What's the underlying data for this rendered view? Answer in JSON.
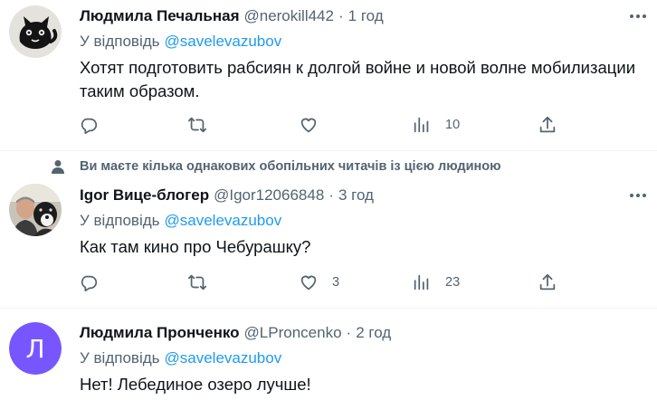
{
  "tweets": [
    {
      "name": "Людмила Печальная",
      "handle": "@nerokill442",
      "separator": "·",
      "time": "1 год",
      "reply_prefix": "У відповідь",
      "reply_to": "@savelevazubov",
      "text": "Хотят подготовить рабсиян к долгой войне и новой волне мобилизации таким образом.",
      "views": "10",
      "avatar_icon": "black-cat-avatar"
    },
    {
      "social_context": "Ви маєте кілька однакових обопільних читачів із цією людиною",
      "name": "Igor Вице-блогер",
      "handle": "@Igor12066848",
      "separator": "·",
      "time": "3 год",
      "reply_prefix": "У відповідь",
      "reply_to": "@savelevazubov",
      "text": "Как там кино про Чебурашку?",
      "likes": "3",
      "views": "23",
      "avatar_icon": "man-with-dog-avatar"
    },
    {
      "name": "Людмила Пронченко",
      "handle": "@LProncenko",
      "separator": "·",
      "time": "2 год",
      "reply_prefix": "У відповідь",
      "reply_to": "@savelevazubov",
      "text": "Нет! Лебединое озеро лучше!",
      "avatar_letter": "Л",
      "avatar_color": "#7856ff"
    }
  ],
  "colors": {
    "accent": "#1d9bf0",
    "secondary_text": "#536471",
    "divider": "#eff3f4"
  }
}
